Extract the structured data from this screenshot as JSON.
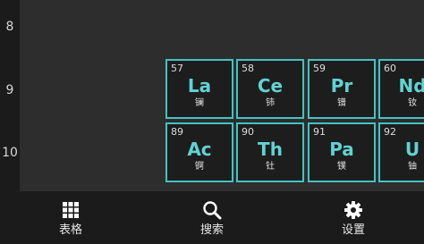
{
  "row_labels": [
    "8",
    "9",
    "10"
  ],
  "cells": [
    {
      "number": "57",
      "symbol": "La",
      "name": "镧"
    },
    {
      "number": "58",
      "symbol": "Ce",
      "name": "铈"
    },
    {
      "number": "59",
      "symbol": "Pr",
      "name": "镨"
    },
    {
      "number": "60",
      "symbol": "Nd",
      "name": "钕"
    },
    {
      "number": "89",
      "symbol": "Ac",
      "name": "锕"
    },
    {
      "number": "90",
      "symbol": "Th",
      "name": "钍"
    },
    {
      "number": "91",
      "symbol": "Pa",
      "name": "镤"
    },
    {
      "number": "92",
      "symbol": "U",
      "name": "铀"
    }
  ],
  "nav": {
    "table_label": "表格",
    "search_label": "搜索",
    "settings_label": "设置",
    "table_icon": "grid-icon",
    "search_icon": "search-icon",
    "settings_icon": "gear-icon"
  },
  "colors": {
    "accent": "#5fd3d3",
    "cell_border": "#45c2c2",
    "background": "#2d2d2d",
    "bar_background": "#1b1b1b"
  }
}
